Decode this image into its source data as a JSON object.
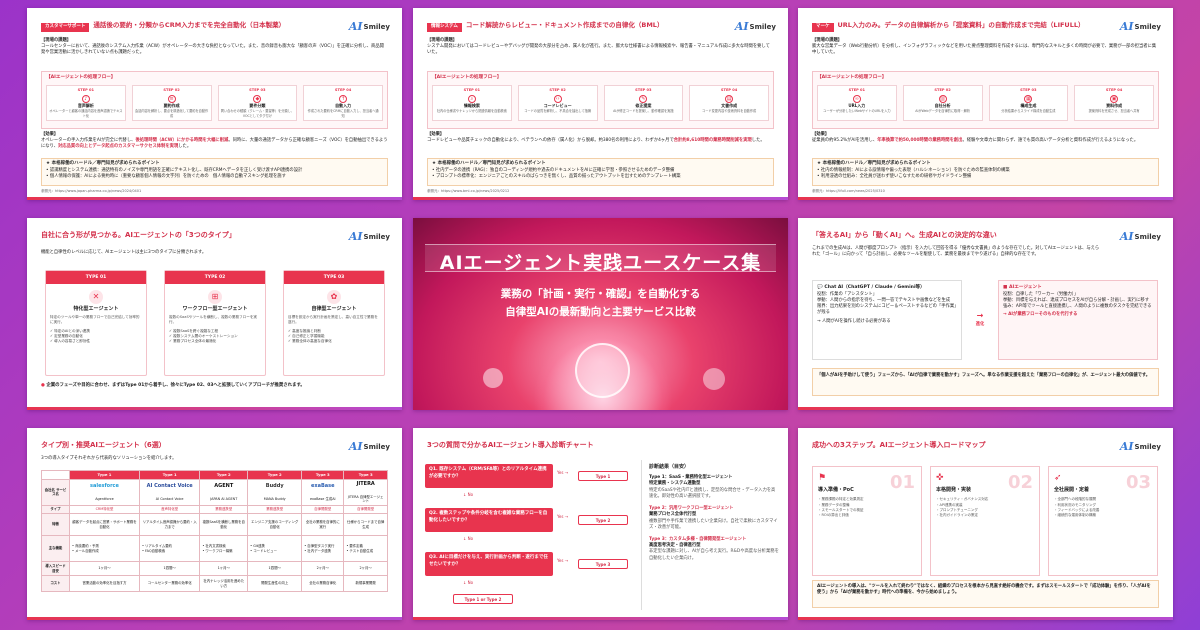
{
  "brand": {
    "ai": "AI",
    "name": "Smiley"
  },
  "center": {
    "title": "AIエージェント実践ユースケース集",
    "subtitle1": "業務の「計画・実行・確認」を自動化する",
    "subtitle2": "自律型AIの最新動向と主要サービス比較"
  },
  "case1": {
    "category": "カスタマーサポート",
    "title": "通話後の要約・分類からCRM入力までを完全自動化（日本製薬）",
    "issue_label": "【現場の課題】",
    "issue": "コールセンターにおいて、通話後のシステム入力作業（ACW）がオペレーターの大きな負担となっていた。また、音の録音も膨大な「顧客の声（VOC）」を正確に分析し、商品開発や営業活動に活かしきれていない点も課題だった。",
    "flow_label": "【AIエージェントの処理フロー】",
    "steps": [
      {
        "no": "STEP 01",
        "name": "音声解析",
        "desc": "オペレーターと顧客の通話内容を音声認識でテキスト化"
      },
      {
        "no": "STEP 02",
        "name": "要約作成",
        "desc": "会話内容を解析し、要点を構造化して要約を自動作成"
      },
      {
        "no": "STEP 03",
        "name": "要件分類",
        "desc": "問い合わせの種類（クレーム・要望等）を分類し、VOCとしてタグ付け"
      },
      {
        "no": "STEP 04",
        "name": "自動入力",
        "desc": "作成された要約をCRMに自動入力し、担当者へ通知"
      }
    ],
    "result_label": "【効果】",
    "result_plain": "オペレーターの手入力作業をAIが完全に代替し、",
    "result_red": "後処理時間（ACW）にかかる時間を大幅に削減",
    "result_tail": "。同時に、大量の通話データから正確な顧客ニーズ（VOC）を自動抽出できるようになり、",
    "result_red2": "対応品質の向上とデータ起点のカスタマーサクセス体制を実現",
    "result_end": "した。",
    "hint_title": "★ 本格稼働のハードル／専門知見が求められるポイント",
    "hints": [
      "• 認識精度とシステム連携：通話特有のノイズや専門用語を正確にテキスト化し、既存CRMへデータを正しく受け渡すAPI連携の設計",
      "• 個人情報の保護：AIによる要約時に（重要な顧客個人情報の文字列）を防ぐための　個人情報の自動マスキング処理を施す"
    ],
    "ref": "参照元：https://www.japan-pharma.co.jp/news/2024/0401"
  },
  "case2": {
    "category": "情報システム",
    "title": "コード解読からレビュー・ドキュメント作成までの自律化（BML）",
    "issue_label": "【現場の課題】",
    "issue": "システム開発においてはコードレビューやデバッグが開発の大部分を占め、属人化が進行。また、膨大な仕様書による情報検索や、報告書・マニュアル作成に多大な時間を要していた。",
    "flow_label": "【AIエージェントの処理フロー】",
    "steps": [
      {
        "no": "STEP 01",
        "name": "情報検索",
        "desc": "社内の仕様書やナレッジから関連情報を自動検索"
      },
      {
        "no": "STEP 02",
        "name": "コードレビュー",
        "desc": "コードの品質を解析し、不具合を抽出して指摘"
      },
      {
        "no": "STEP 03",
        "name": "修正提案",
        "desc": "AIが修正コードを提案し、動作確認を実施"
      },
      {
        "no": "STEP 04",
        "name": "文書作成",
        "desc": "コード変更内容や技術資料を自動作成"
      }
    ],
    "result_label": "【効果】",
    "result_plain": "コードレビューや品質チェックの自動化により、ベテランへの依存（属人化）から脱却。約380名の利用により、わずか4ヶ月で",
    "result_red": "合計約8,610時間の業務時間削減を実現",
    "result_end": "した。",
    "hint_title": "★ 本格稼働のハードル／専門知見が求められるポイント",
    "hints": [
      "• 社内データの連携（RAG）：独自のコーディング規約や過去のドキュメントをAIに正確に学習・参照させるためのデータ整備",
      "• プロンプトの標準化：エンジニアごとのスキルのばらつきを無くし、品質の揃ったアウトプットを出すためのテンプレート構築"
    ],
    "ref": "参照元：https://www.bml.co.jp/news/2025/0212"
  },
  "case3": {
    "category": "マーケ",
    "title": "URL入力のみ。データの自律解析から「提案資料」の自動作成まで完結（LIFULL）",
    "issue_label": "【現場の課題】",
    "issue": "膨大な営業データ（Web行動分析）を分析し、インフォグラフィックなどを用いた要点整理資料を作成するには、専門的なスキルと多くの時間が必要で、業務が一部の担当者に集中していた。",
    "flow_label": "【AIエージェントの処理フロー】",
    "steps": [
      {
        "no": "STEP 01",
        "name": "URL入力",
        "desc": "ユーザーが分析したいWebサイトのURLを入力"
      },
      {
        "no": "STEP 02",
        "name": "自社分析",
        "desc": "AIがWebデータを自律的に取得・解析"
      },
      {
        "no": "STEP 03",
        "name": "構成生成",
        "desc": "分析結果からスライド構成を自動生成"
      },
      {
        "no": "STEP 04",
        "name": "資料作成",
        "desc": "提案資料を完成させ、担当者へ共有"
      }
    ],
    "result_label": "【効果】",
    "result_plain": "従業員の約95.2%がAIを活用し、",
    "result_red": "年率換算で約50,000時間の業務時間を創出",
    "result_tail": "。",
    "result_end": "経験や文章力に関わらず、誰でも質の高いデータ分析と資料作成が行えるようになった。",
    "hint_title": "★ 本格稼働のハードル／専門知見が求められるポイント",
    "hints": [
      "• 社内の情報統制：AIによる誤情報や偏った表現（ハルシネーション）を防ぐための監査体制の構築",
      "• 利用浸透の仕組み：全社員が迷わず使いこなすための研修やガイドライン整備"
    ],
    "ref": "参照元：https://lifull.com/news/2025/0310"
  },
  "types": {
    "title": "自社に合う形が見つかる。AIエージェントの「3つのタイプ」",
    "intro": "機能と自律性のレベルに応じて、AIエージェントは主に3つのタイプに分類されます。",
    "cards": [
      {
        "head": "TYPE 01",
        "name": "特化型エージェント",
        "desc": "特定のツールや単一の業務フローで自己完結して効率的に実行。",
        "items": [
          "✓ 特定のAIとの深い連携",
          "✓ 定型業務の自動化",
          "✓ 導入の容易さと即効性"
        ]
      },
      {
        "head": "TYPE 02",
        "name": "ワークフロー型エージェント",
        "desc": "複数のSaaSやツールを横断し、複数の業務フローを実行。",
        "items": [
          "✓ 複数SaaSを跨ぐ複雑な工程",
          "✓ 複数システム間のオーケストレーション",
          "✓ 業務プロセス全体の最適化"
        ]
      },
      {
        "head": "TYPE 03",
        "name": "自律型エージェント",
        "desc": "目標を設定から実行計画を策定し、高い自立性で業務を遂行。",
        "items": [
          "✓ 高度な推論と判断",
          "✓ 自己修正と学習機能",
          "✓ 業務全体の高度な自律化"
        ]
      }
    ],
    "note": "企業のフェーズや目的に合わせ、まずはType 01から着手し、徐々にType 02、03へと拡張していくアプローチが推奨されます。"
  },
  "diff": {
    "title": "「答えるAI」から「動くAI」へ。生成AIとの決定的な違い",
    "intro": "これまでの生成AIは、人間が都度プロンプト（指示）を入力して回答を得る「優秀な文書員」のような存在でした。対してAIエージェントは、与えられた「ゴール」に向かって「自ら計画し、必要なツールを駆使して、業務を最後までやり遂げる」自律的な存在です。",
    "left_head": "Chat AI（ChatGPT / Claude / Gemini等）",
    "left_items": [
      "役割：作業の「アシスタント」",
      "挙動：人間からの指示を待ち、一問一答でテキストや画像などを生成",
      "限界：出力結果を別のシステムにコピー＆ペーストするなどの「手作業」が残る"
    ],
    "left_note": "→ 人間がAIを操作し続ける必要がある",
    "arrow": "進化",
    "right_head": "AIエージェント",
    "right_items": [
      "役割：自律した「ワーカー（労働力）」",
      "挙動：目標を与えれば、達成プロセスをAIが自ら分解・計画し、実行に移す",
      "強み：API等でツールと直接連携し、人間のように複数のタスクを完結できる"
    ],
    "right_note": "→ AIが業務フローそのものを代行する",
    "bottom": "「個人がAIを手助けして使う」フェーズから、「AIが自律で業務を動かす」フェーズへ。単なる作業支援を超えた「業務フローの自律化」が、エージェント最大の価値です。"
  },
  "picks": {
    "title": "タイプ別・推奨AIエージェント（6選）",
    "intro": "3つの導入タイプそれぞれから代表的なソリューションを紹介します。",
    "types": [
      "Type 1",
      "Type 1",
      "Type 2",
      "Type 2",
      "Type 3",
      "Type 3"
    ],
    "row_label_service": "会社名 サービス名",
    "logos": [
      "salesforce",
      "AI Contact Voice",
      "AGENT",
      "Buddy",
      "exaBase",
      "JITERA"
    ],
    "names": [
      "Agentforce",
      "AI Contact Voice",
      "JAPAN AI AGENT",
      "MANA Buddy",
      "exaBase 生成AI",
      "JITERA 自律型エージェント"
    ],
    "rows": [
      {
        "label": "タイプ",
        "cells": [
          "CRM特化型",
          "音声特化型",
          "業務連携型",
          "業務連携型",
          "自律開発型",
          "自律開発型"
        ]
      },
      {
        "label": "特徴",
        "cells": [
          "顧客データを起点に営業・サポート業務を自動化",
          "リアルタイム音声認識から要約・入力まで",
          "複数SaaSを横断し業務を自動化",
          "エンジニア支援のコーディング自動化",
          "全社の業務を自律的に実行",
          "仕様からコードまで自律生成"
        ]
      },
      {
        "label": "主な機能",
        "cells": [
          "• 商談要約・予測\n• メール自動作成",
          "• リアルタイム要約\n• FAQ自動検索",
          "• 社内文書検索\n• ワークフロー構築",
          "• Git連携\n• コードレビュー",
          "• 自律型タスク実行\n• 社内データ連携",
          "• 要件定義\n• テスト自動生成"
        ]
      },
      {
        "label": "導入スピード目安",
        "cells": [
          "1ヶ月〜",
          "1週間〜",
          "1ヶ月〜",
          "1週間〜",
          "2ヶ月〜",
          "2ヶ月〜"
        ]
      },
      {
        "label": "コスト",
        "cells": [
          "営業活動の効率化を目指す方",
          "コールセンター業務の効率化",
          "社内ナレッジ活用を進めたい方",
          "開発生産性の向上",
          "全社の業務自律化",
          "新規事業開発"
        ]
      }
    ]
  },
  "diag": {
    "title": "3つの質問で分かるAIエージェント導入診断チャート",
    "q1": "Q1. 既存システム（CRM/SFA等）とのリアルタイム連携が必要ですか？",
    "q2": "Q2. 複数ステップや条件分岐を含む複雑な業務フローを自動化したいですか？",
    "q3": "Q3. AIに目標だけを与え、実行計画から判断・遂行まで任せたいですか？",
    "yes": "Yes",
    "no": "No",
    "a1": "Type 1",
    "a2": "Type 2",
    "a3": "Type 3",
    "a4": "Type 1 or Type 2",
    "result_head": "診断結果（目安）",
    "results": [
      {
        "t": "Type 1：SaaS・業務特化型エージェント",
        "s": "特定業務・システム連動型",
        "d": "特定のSaaSや社内ITと連携し、定型的な問合せ・データ入力を高速化。即効性の高い選択肢です。"
      },
      {
        "t": "Type 2：汎用ワークフロー型エージェント",
        "s": "業務プロセス全体代行型",
        "d": "複数部門や手作業で連携したい企業向け。自社で柔軟にカスタマイズ・改善が可能。"
      },
      {
        "t": "Type 3：カスタム多様・自律開発型エージェント",
        "s": "高度思考決定・自律進行型",
        "d": "非定型な課題に対し、AIが自ら考え実行。R&Dや高度な分析業務を自動化したい企業向け。"
      }
    ]
  },
  "road": {
    "title": "成功への3ステップ。AIエージェント導入ロードマップ",
    "cards": [
      {
        "no": "01",
        "name": "導入準備・PoC",
        "items": [
          "・業務課題の特定と効果測定",
          "・業務データの整備",
          "・スモールスタートでの検証",
          "・ROIの算出と評価"
        ]
      },
      {
        "no": "02",
        "name": "本格開発・実装",
        "items": [
          "・セキュリティ・ガバナンス対応",
          "・API連携の実装",
          "・プロンプトチューニング",
          "・社内ガイドラインの策定"
        ]
      },
      {
        "no": "03",
        "name": "全社展開・定着",
        "items": [
          "・全部門への段階的な展開",
          "・利用状況のモニタリング",
          "・フィードバックによる改善",
          "・継続的な運用体制の構築"
        ]
      }
    ],
    "note": "AIエージェントの導入は、\"ツールを入れて終わり\"ではなく、組織のプロセスを根本から見直す絶好の機会です。まずはスモールスタートで「成功体験」を作り、「人がAIを使う」から「AIが業務を動かす」時代への準備を、今から始めましょう。"
  },
  "colors": {
    "accent": "#e8344e",
    "brand_blue": "#3a7bd5",
    "bg_purple": "#b63fb8"
  }
}
